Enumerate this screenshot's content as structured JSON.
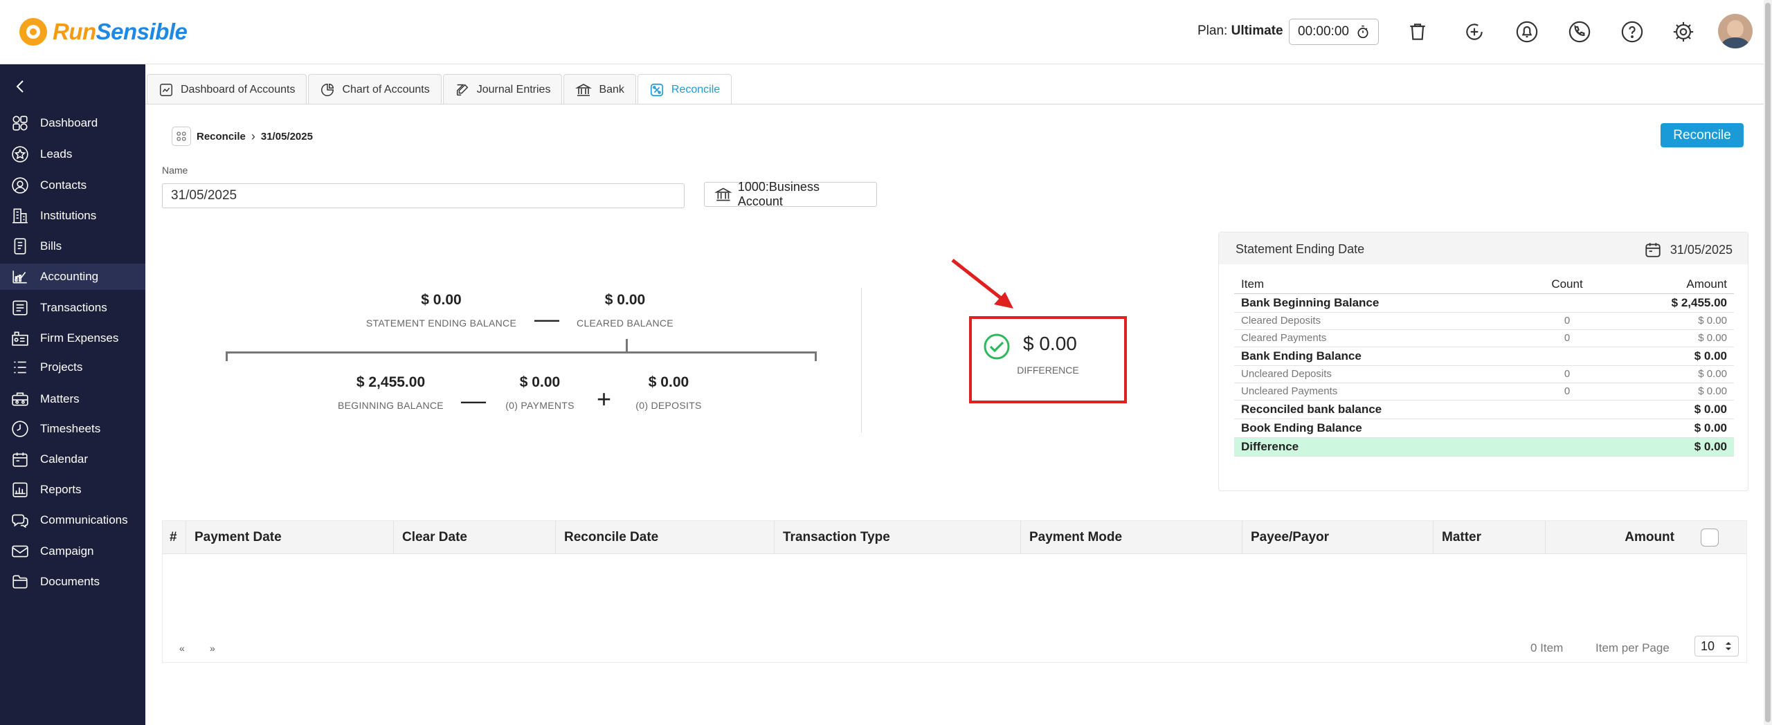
{
  "header": {
    "logo_run": "Run",
    "logo_sensible": "Sensible",
    "plan_label": "Plan:",
    "plan_value": "Ultimate",
    "timer": "00:00:00"
  },
  "sidebar": {
    "items": [
      {
        "label": "Dashboard",
        "icon": "dashboard-icon"
      },
      {
        "label": "Leads",
        "icon": "star-icon"
      },
      {
        "label": "Contacts",
        "icon": "user-circle-icon"
      },
      {
        "label": "Institutions",
        "icon": "building-icon"
      },
      {
        "label": "Bills",
        "icon": "bill-icon"
      },
      {
        "label": "Accounting",
        "icon": "accounting-icon"
      },
      {
        "label": "Transactions",
        "icon": "transactions-icon"
      },
      {
        "label": "Firm Expenses",
        "icon": "firm-expenses-icon"
      },
      {
        "label": "Projects",
        "icon": "projects-icon"
      },
      {
        "label": "Matters",
        "icon": "matters-icon"
      },
      {
        "label": "Timesheets",
        "icon": "clock-icon"
      },
      {
        "label": "Calendar",
        "icon": "calendar-icon"
      },
      {
        "label": "Reports",
        "icon": "reports-icon"
      },
      {
        "label": "Communications",
        "icon": "communications-icon"
      },
      {
        "label": "Campaign",
        "icon": "mail-icon"
      },
      {
        "label": "Documents",
        "icon": "folder-icon"
      }
    ],
    "active": "Accounting"
  },
  "tabs": [
    {
      "label": "Dashboard of Accounts"
    },
    {
      "label": "Chart of Accounts"
    },
    {
      "label": "Journal Entries"
    },
    {
      "label": "Bank"
    },
    {
      "label": "Reconcile"
    }
  ],
  "breadcrumb": {
    "root": "Reconcile",
    "current": "31/05/2025"
  },
  "reconcile_button": "Reconcile",
  "form": {
    "name_label": "Name",
    "name_value": "31/05/2025",
    "account": "1000:Business Account"
  },
  "formula": {
    "statement_ending_balance": {
      "value": "$ 0.00",
      "label": "STATEMENT ENDING BALANCE"
    },
    "cleared_balance": {
      "value": "$ 0.00",
      "label": "CLEARED BALANCE"
    },
    "beginning_balance": {
      "value": "$ 2,455.00",
      "label": "BEGINNING BALANCE"
    },
    "payments": {
      "value": "$ 0.00",
      "label": "(0) PAYMENTS"
    },
    "deposits": {
      "value": "$ 0.00",
      "label": "(0) DEPOSITS"
    },
    "minus": "—",
    "minus2": "—",
    "plus": "+"
  },
  "difference": {
    "value": "$ 0.00",
    "label": "DIFFERENCE"
  },
  "statement": {
    "title": "Statement Ending Date",
    "date": "31/05/2025",
    "columns": {
      "item": "Item",
      "count": "Count",
      "amount": "Amount"
    },
    "rows": [
      {
        "item": "Bank Beginning Balance",
        "count": "",
        "amount": "$ 2,455.00"
      },
      {
        "item": "Cleared Deposits",
        "count": "0",
        "amount": "$ 0.00"
      },
      {
        "item": "Cleared Payments",
        "count": "0",
        "amount": "$ 0.00"
      },
      {
        "item": "Bank Ending Balance",
        "count": "",
        "amount": "$ 0.00"
      },
      {
        "item": "Uncleared Deposits",
        "count": "0",
        "amount": "$ 0.00"
      },
      {
        "item": "Uncleared Payments",
        "count": "0",
        "amount": "$ 0.00"
      },
      {
        "item": "Reconciled bank balance",
        "count": "",
        "amount": "$ 0.00"
      },
      {
        "item": "Book Ending Balance",
        "count": "",
        "amount": "$ 0.00"
      },
      {
        "item": "Difference",
        "count": "",
        "amount": "$ 0.00"
      }
    ]
  },
  "transactions": {
    "columns": [
      "#",
      "Payment Date",
      "Clear Date",
      "Reconcile Date",
      "Transaction Type",
      "Payment Mode",
      "Payee/Payor",
      "Matter",
      "Amount"
    ],
    "prev": "«",
    "next": "»",
    "item_count": "0 Item",
    "per_page_label": "Item per Page",
    "per_page_value": "10"
  },
  "colors": {
    "accent": "#1a9bd7",
    "sidebar": "#1b1f3b",
    "highlight": "#e02020",
    "success": "#2eb85c"
  }
}
